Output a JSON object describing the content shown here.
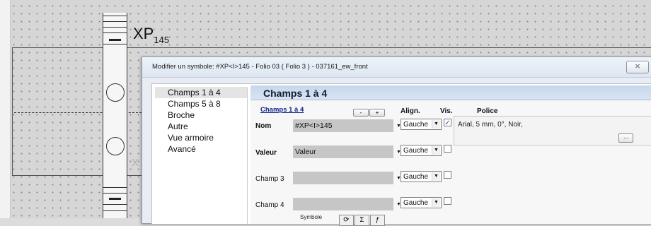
{
  "drawing": {
    "symbol_label": "XP",
    "symbol_subscript": "145",
    "ghost_mark": "X"
  },
  "dialog": {
    "title": "Modifier un symbole: #XP<I>145 - Folio 03 ( Folio 3 ) - 037161_ew_front",
    "close_glyph": "⨯",
    "nav": {
      "items": [
        {
          "label": "Champs 1 à 4",
          "active": true
        },
        {
          "label": "Champs 5 à 8",
          "active": false
        },
        {
          "label": "Broche",
          "active": false
        },
        {
          "label": "Autre",
          "active": false
        },
        {
          "label": "Vue armoire",
          "active": false
        },
        {
          "label": "Avancé",
          "active": false
        }
      ]
    },
    "panel": {
      "heading": "Champs 1 à 4",
      "fields_link": "Champs 1 à 4",
      "minus_label": "-",
      "plus_label": "+",
      "columns": {
        "align": "Align.",
        "vis": "Vis.",
        "police": "Police"
      },
      "rows": [
        {
          "label": "Nom",
          "bold": true,
          "value": "#XP<I>145",
          "align": "Gauche",
          "visible": true
        },
        {
          "label": "Valeur",
          "bold": true,
          "value": "Valeur",
          "align": "Gauche",
          "visible": false
        },
        {
          "label": "Champ 3",
          "bold": false,
          "value": "",
          "align": "Gauche",
          "visible": false
        },
        {
          "label": "Champ 4",
          "bold": false,
          "value": "",
          "align": "Gauche",
          "visible": false
        }
      ],
      "police_text": "Arial, 5 mm, 0°, Noir,",
      "police_button": "...",
      "symbol_caption": "Symbole"
    }
  }
}
